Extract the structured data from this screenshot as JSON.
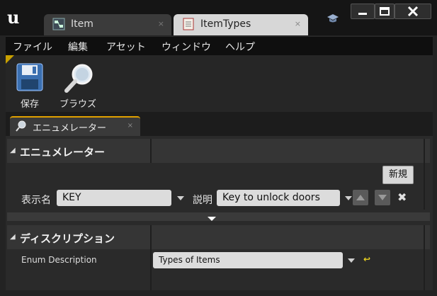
{
  "tabs": [
    {
      "label": "Item",
      "close": "×"
    },
    {
      "label": "ItemTypes",
      "close": "×"
    }
  ],
  "menu": [
    "ファイル",
    "編集",
    "アセット",
    "ウィンドウ",
    "ヘルプ"
  ],
  "toolbar": {
    "save_label": "保存",
    "browse_label": "ブラウズ"
  },
  "panel_tab": {
    "label": "エニュメレーター",
    "close": "×"
  },
  "enumerators_section": {
    "title": "エニュメレーター",
    "new_button": "新規",
    "display_name_label": "表示名",
    "display_name_value": "KEY",
    "description_label": "説明",
    "description_value": "Key to unlock doors"
  },
  "description_section": {
    "title": "ディスクリプション",
    "enum_description_label": "Enum Description",
    "enum_description_value": "Types of Items"
  },
  "colors": {
    "accent": "#e0a000",
    "reset": "#e8d020"
  }
}
